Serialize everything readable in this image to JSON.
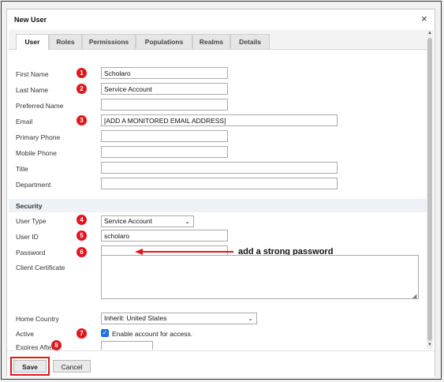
{
  "dialog": {
    "title": "New User",
    "close_glyph": "×"
  },
  "tabs": [
    {
      "label": "User",
      "active": true
    },
    {
      "label": "Roles",
      "active": false
    },
    {
      "label": "Permissions",
      "active": false
    },
    {
      "label": "Populations",
      "active": false
    },
    {
      "label": "Realms",
      "active": false
    },
    {
      "label": "Details",
      "active": false
    }
  ],
  "fields": {
    "first_name": {
      "label": "First Name",
      "value": "Scholaro"
    },
    "last_name": {
      "label": "Last Name",
      "value": "Service Account"
    },
    "preferred_name": {
      "label": "Preferred Name",
      "value": ""
    },
    "email": {
      "label": "Email",
      "value": "[ADD A MONITORED EMAIL ADDRESS]"
    },
    "primary_phone": {
      "label": "Primary Phone",
      "value": ""
    },
    "mobile_phone": {
      "label": "Mobile Phone",
      "value": ""
    },
    "title": {
      "label": "Title",
      "value": ""
    },
    "department": {
      "label": "Department",
      "value": ""
    }
  },
  "security": {
    "header": "Security",
    "user_type": {
      "label": "User Type",
      "value": "Service Account"
    },
    "user_id": {
      "label": "User ID",
      "value": "scholaro"
    },
    "password": {
      "label": "Password",
      "value": ""
    },
    "client_certificate": {
      "label": "Client Certificate",
      "value": ""
    },
    "home_country": {
      "label": "Home Country",
      "value": "Inherit: United States"
    },
    "active": {
      "label": "Active",
      "checked": true,
      "checkbox_label": "Enable account for access."
    },
    "expires_after": {
      "label": "Expires After",
      "value": ""
    }
  },
  "badges": [
    "1",
    "2",
    "3",
    "4",
    "5",
    "6",
    "7",
    "8"
  ],
  "annotation": {
    "text": "add a strong password"
  },
  "footer": {
    "save_label": "Save",
    "cancel_label": "Cancel"
  },
  "icons": {
    "chevron_down": "⌄",
    "check": "✓",
    "scroll_up": "▲",
    "scroll_down": "▼",
    "resize_grip": "◢"
  },
  "colors": {
    "badge_red": "#e0161e",
    "checkbox_blue": "#1f6fe5",
    "section_header_bg": "#eef2f7"
  }
}
